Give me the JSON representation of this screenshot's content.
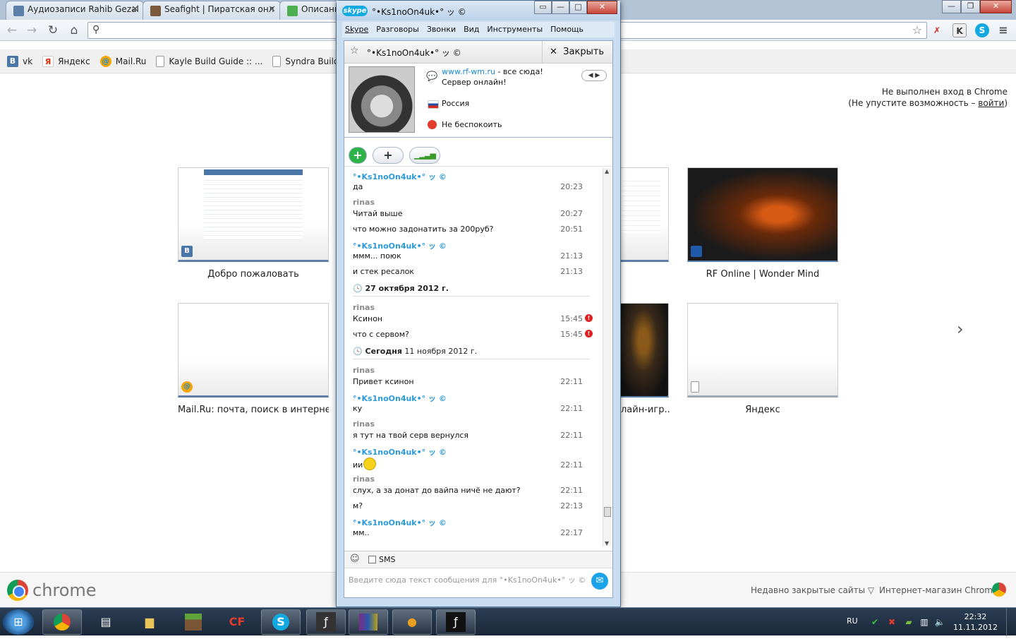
{
  "chrome": {
    "tabs": [
      {
        "title": "Аудиозаписи Rahib Gezal",
        "icon": "pause-icon",
        "color": "#5b7fa8"
      },
      {
        "title": "Seafight | Пиратская онл",
        "icon": "ship-icon",
        "color": "#7b5a3c"
      },
      {
        "title": "Описани",
        "icon": "chat-bubble-icon",
        "color": "#4caf50"
      }
    ],
    "bookmarks": [
      {
        "label": "vk",
        "icon": "В",
        "color": "#4a76a8"
      },
      {
        "label": "Яндекс",
        "icon": "Я",
        "color": "#e62e04"
      },
      {
        "label": "Mail.Ru",
        "icon": "@",
        "color": "#168de2"
      },
      {
        "label": "Kayle Build Guide :: ...",
        "icon": "",
        "color": ""
      },
      {
        "label": "Syndra Build Guide",
        "icon": "",
        "color": ""
      }
    ],
    "signin": {
      "line1": "Не выполнен вход в Chrome",
      "line2_prefix": "(Не упустите возможность – ",
      "link": "войти",
      "line2_suffix": ")"
    },
    "thumbnails": [
      {
        "caption": "Добро пожаловать",
        "fav": "В",
        "fav_color": "#4a76a8"
      },
      {
        "caption": "RF Online | Wonder Mind",
        "fav": "",
        "fav_color": "#1f5aa8"
      },
      {
        "caption": "Mail.Ru: почта, поиск в интерне...",
        "fav": "@",
        "fav_color": "#168de2"
      },
      {
        "caption": "лайн-игр...",
        "fav": "",
        "fav_color": ""
      },
      {
        "caption": "Яндекс",
        "fav": "",
        "fav_color": ""
      }
    ],
    "next_arrow": "›",
    "bottom": {
      "logo_text": "chrome",
      "recent": "Недавно закрытые сайты ▽",
      "store": "Интернет-магазин Chrome"
    }
  },
  "skype": {
    "window_title": "°•Ks1noOn4uk•° ッ ©",
    "logo": "skype",
    "menu": [
      "Skype",
      "Разговоры",
      "Звонки",
      "Вид",
      "Инструменты",
      "Помощь"
    ],
    "contact_name": "°•Ks1noOn4uk•° ッ ©",
    "close_label": "Закрыть",
    "mood_link": "www.rf-wm.ru",
    "mood_rest": " - все сюда!",
    "mood_line2": "Сервер онлайн!",
    "country": "Россия",
    "status": "Не беспокоить",
    "input_placeholder": "Введите сюда текст сообщения для °•Ks1noOn4uk•° ッ ©",
    "sms_label": "SMS",
    "messages": [
      {
        "author": "°•Ks1noOn4uk•° ッ ©",
        "rinas": false,
        "lines": [
          {
            "text": "да",
            "time": "20:23"
          }
        ]
      },
      {
        "author": "rinas",
        "rinas": true,
        "lines": [
          {
            "text": "Читай выше",
            "time": "20:27"
          },
          {
            "text": "что можно задонатить за 200руб?",
            "time": "20:51"
          }
        ]
      },
      {
        "author": "°•Ks1noOn4uk•° ッ ©",
        "rinas": false,
        "lines": [
          {
            "text": "ммм... поюк",
            "time": "21:13"
          },
          {
            "text": "и стек ресалок",
            "time": "21:13"
          }
        ]
      },
      {
        "date": "27 октября 2012 г."
      },
      {
        "author": "rinas",
        "rinas": true,
        "lines": [
          {
            "text": "Ксинон",
            "time": "15:45",
            "error": true
          },
          {
            "text": "что с сервом?",
            "time": "15:45",
            "error": true
          }
        ]
      },
      {
        "date_bold": "Сегодня",
        "date": " 11 ноября 2012 г."
      },
      {
        "author": "rinas",
        "rinas": true,
        "lines": [
          {
            "text": "Привет ксинон",
            "time": "22:11"
          }
        ]
      },
      {
        "author": "°•Ks1noOn4uk•° ッ ©",
        "rinas": false,
        "lines": [
          {
            "text": "ку",
            "time": "22:11"
          }
        ]
      },
      {
        "author": "rinas",
        "rinas": true,
        "lines": [
          {
            "text": "я  тут на твой серв вернулся",
            "time": "22:11"
          }
        ]
      },
      {
        "author": "°•Ks1noOn4uk•° ッ ©",
        "rinas": false,
        "lines": [
          {
            "text": "ии",
            "time": "22:11",
            "emoji": true
          }
        ]
      },
      {
        "author": "rinas",
        "rinas": true,
        "lines": [
          {
            "text": "слух, а за донат до вайпа ничё не дают?",
            "time": "22:11"
          },
          {
            "text": "м?",
            "time": "22:13"
          }
        ]
      },
      {
        "author": "°•Ks1noOn4uk•° ッ ©",
        "rinas": false,
        "lines": [
          {
            "text": "мм..",
            "time": "22:17"
          }
        ]
      }
    ]
  },
  "taskbar": {
    "lang": "RU",
    "time": "22:32",
    "date": "11.11.2012"
  }
}
